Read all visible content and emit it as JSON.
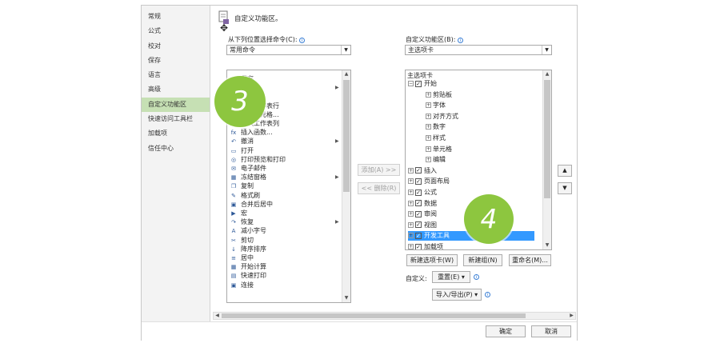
{
  "sidebar": {
    "items": [
      {
        "label": "常规"
      },
      {
        "label": "公式"
      },
      {
        "label": "校对"
      },
      {
        "label": "保存"
      },
      {
        "label": "语言"
      },
      {
        "label": "高级"
      },
      {
        "label": "自定义功能区",
        "selected": true
      },
      {
        "label": "快速访问工具栏"
      },
      {
        "label": "加载项"
      },
      {
        "label": "信任中心"
      }
    ]
  },
  "header": {
    "title": "自定义功能区。"
  },
  "left": {
    "choose_label": "从下列位置选择命令(C):",
    "choose_value": "常用命令",
    "commands": [
      {
        "icon": "save-icon",
        "glyph": "▢",
        "label": "保存"
      },
      {
        "icon": "print-icon",
        "glyph": "▤",
        "label": "",
        "submenu": true
      },
      {
        "icon": "blank-icon",
        "glyph": "",
        "label": ""
      },
      {
        "icon": "insert-rows-icon",
        "glyph": "",
        "label": "插入工作表行"
      },
      {
        "icon": "insert-cells-icon",
        "glyph": "",
        "label": "插入单元格..."
      },
      {
        "icon": "insert-columns-icon",
        "glyph": "",
        "label": "插入工作表列"
      },
      {
        "icon": "function-icon",
        "glyph": "fx",
        "label": "插入函数..."
      },
      {
        "icon": "undo-icon",
        "glyph": "↶",
        "label": "撤消",
        "submenu": true
      },
      {
        "icon": "open-icon",
        "glyph": "▭",
        "label": "打开"
      },
      {
        "icon": "print-preview-icon",
        "glyph": "◎",
        "label": "打印预览和打印"
      },
      {
        "icon": "email-icon",
        "glyph": "✉",
        "label": "电子邮件"
      },
      {
        "icon": "freeze-panes-icon",
        "glyph": "▦",
        "label": "冻结窗格",
        "submenu": true
      },
      {
        "icon": "copy-icon",
        "glyph": "❐",
        "label": "复制"
      },
      {
        "icon": "format-painter-icon",
        "glyph": "✎",
        "label": "格式刷"
      },
      {
        "icon": "merge-center-icon",
        "glyph": "▣",
        "label": "合并后居中"
      },
      {
        "icon": "macro-icon",
        "glyph": "▶",
        "label": "宏"
      },
      {
        "icon": "redo-icon",
        "glyph": "↷",
        "label": "恢复",
        "submenu": true
      },
      {
        "icon": "decrease-font-icon",
        "glyph": "A",
        "label": "减小字号"
      },
      {
        "icon": "cut-icon",
        "glyph": "✂",
        "label": "剪切"
      },
      {
        "icon": "sort-descending-icon",
        "glyph": "↓",
        "label": "降序排序"
      },
      {
        "icon": "center-icon",
        "glyph": "≡",
        "label": "居中"
      },
      {
        "icon": "calculate-icon",
        "glyph": "▦",
        "label": "开始计算"
      },
      {
        "icon": "quick-print-icon",
        "glyph": "▤",
        "label": "快速打印"
      },
      {
        "icon": "connections-icon",
        "glyph": "▣",
        "label": "连接"
      }
    ]
  },
  "middle": {
    "add_label": "添加(A) >>",
    "remove_label": "<< 删除(R)"
  },
  "right": {
    "customize_label": "自定义功能区(B):",
    "customize_value": "主选项卡",
    "tree_header": "主选项卡",
    "tree": [
      {
        "label": "开始",
        "level": 0,
        "expander": "⊟",
        "checked": true
      },
      {
        "label": "剪贴板",
        "level": 1,
        "expander": "⊞"
      },
      {
        "label": "字体",
        "level": 1,
        "expander": "⊞"
      },
      {
        "label": "对齐方式",
        "level": 1,
        "expander": "⊞"
      },
      {
        "label": "数字",
        "level": 1,
        "expander": "⊞"
      },
      {
        "label": "样式",
        "level": 1,
        "expander": "⊞"
      },
      {
        "label": "单元格",
        "level": 1,
        "expander": "⊞"
      },
      {
        "label": "编辑",
        "level": 1,
        "expander": "⊞"
      },
      {
        "label": "插入",
        "level": 0,
        "expander": "⊞",
        "checked": true
      },
      {
        "label": "页面布局",
        "level": 0,
        "expander": "⊞",
        "checked": true
      },
      {
        "label": "公式",
        "level": 0,
        "expander": "⊞",
        "checked": true
      },
      {
        "label": "数据",
        "level": 0,
        "expander": "⊞",
        "checked": true
      },
      {
        "label": "审阅",
        "level": 0,
        "expander": "⊞",
        "checked": true
      },
      {
        "label": "视图",
        "level": 0,
        "expander": "⊞",
        "checked": true
      },
      {
        "label": "开发工具",
        "level": 0,
        "expander": "⊞",
        "checked": true,
        "selected": true
      },
      {
        "label": "加载项",
        "level": 0,
        "expander": "⊞",
        "checked": true
      }
    ],
    "new_tab_label": "新建选项卡(W)",
    "new_group_label": "新建组(N)",
    "rename_label": "重命名(M)...",
    "customizations_label": "自定义:",
    "reset_label": "重置(E) ▾",
    "import_export_label": "导入/导出(P) ▾"
  },
  "footer": {
    "ok_label": "确定",
    "cancel_label": "取消"
  },
  "callouts": {
    "step3": "3",
    "step4": "4"
  },
  "colors": {
    "callout": "#8dc63f",
    "selection": "#3399ff",
    "sidebar_selection": "#c6e0b4"
  }
}
